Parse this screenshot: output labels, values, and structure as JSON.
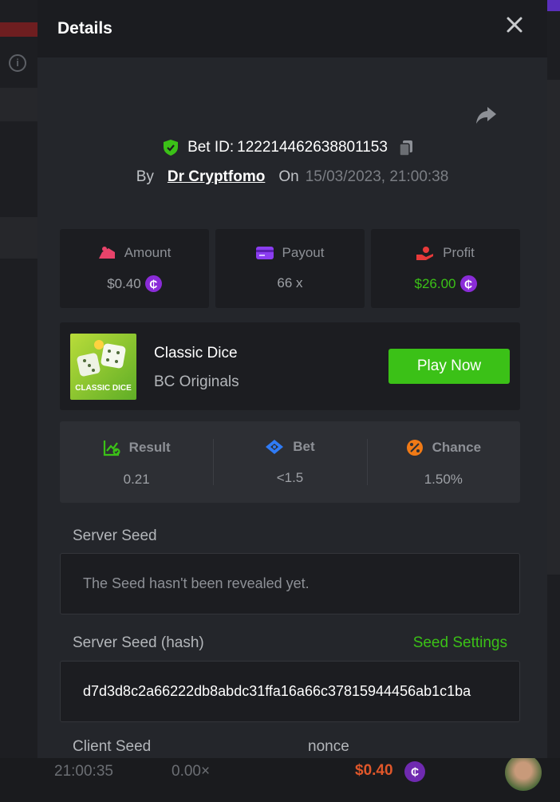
{
  "modal": {
    "title": "Details",
    "bet_id_label": "Bet ID:",
    "bet_id": "122214462638801153",
    "by_label": "By",
    "user": "Dr Cryptfomo",
    "on_label": "On",
    "date": "15/03/2023, 21:00:38"
  },
  "stats": [
    {
      "label": "Amount",
      "value": "$0.40",
      "icon": "amount-icon",
      "color": "#e8436a"
    },
    {
      "label": "Payout",
      "value": "66 x",
      "icon": "payout-icon",
      "color": "#8b3df0"
    },
    {
      "label": "Profit",
      "value": "$26.00",
      "icon": "profit-icon",
      "color": "#e83a3a"
    }
  ],
  "coin_symbol": "₵",
  "game": {
    "name": "Classic Dice",
    "provider": "BC Originals",
    "thumb_text": "CLASSIC DICE",
    "play_label": "Play Now"
  },
  "results": [
    {
      "label": "Result",
      "value": "0.21",
      "icon": "result-chart-icon"
    },
    {
      "label": "Bet",
      "value": "<1.5",
      "icon": "bet-target-icon"
    },
    {
      "label": "Chance",
      "value": "1.50%",
      "icon": "percent-icon"
    }
  ],
  "seeds": {
    "server_seed_label": "Server Seed",
    "server_seed_value": "The Seed hasn't been revealed yet.",
    "server_hash_label": "Server Seed (hash)",
    "seed_settings": "Seed Settings",
    "server_hash_value": "d7d3d8c2a66222db8abdc31ffa16a66c37815944456ab1c1ba",
    "client_seed_label": "Client Seed",
    "nonce_label": "nonce"
  },
  "background": {
    "bottom_time": "21:00:35",
    "bottom_multiplier": "0.00×",
    "bottom_amount": "$0.40"
  },
  "colors": {
    "accent_green": "#3bc117",
    "coin_purple": "#8a2cd8"
  }
}
